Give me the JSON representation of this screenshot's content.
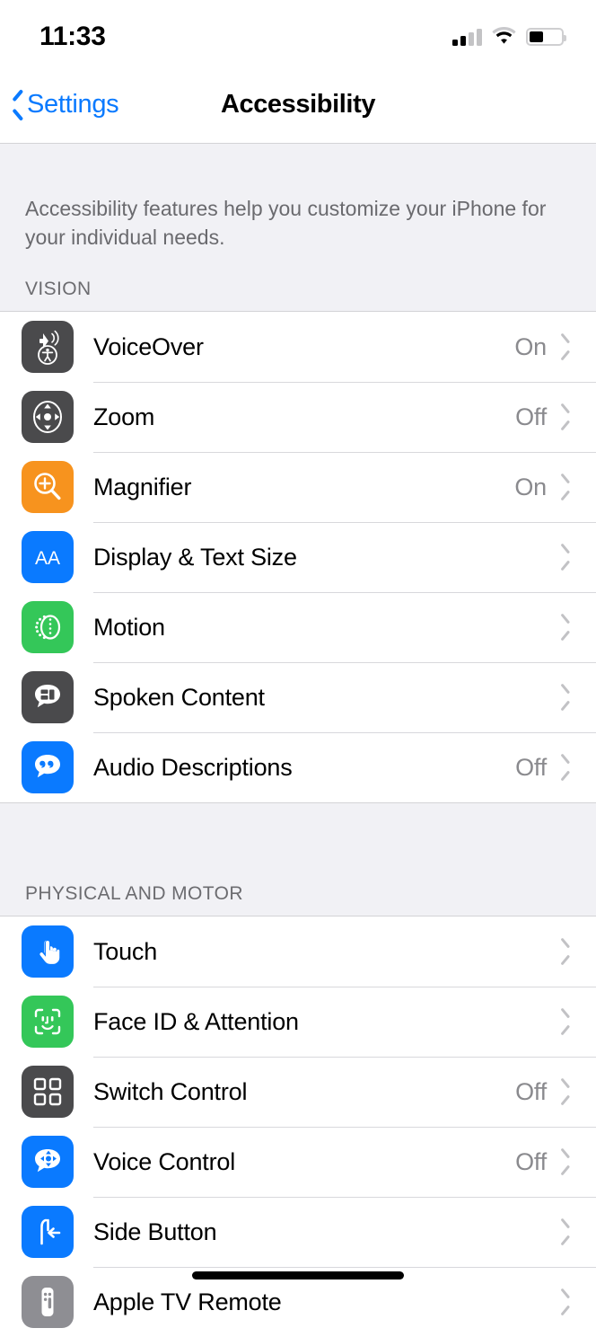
{
  "status_bar": {
    "time": "11:33",
    "signal_icon": "cellular-signal-icon",
    "signal_bars_filled": 2,
    "signal_bars_total": 4,
    "wifi_icon": "wifi-icon",
    "battery_icon": "battery-icon",
    "battery_level_percent": 45
  },
  "nav": {
    "back_label": "Settings",
    "back_icon": "chevron-left-icon",
    "title": "Accessibility"
  },
  "intro": {
    "text": "Accessibility features help you customize your iPhone for your individual needs."
  },
  "sections": [
    {
      "header": "VISION",
      "rows": [
        {
          "label": "VoiceOver",
          "value": "On",
          "icon": "voiceover-icon",
          "icon_color": "#4a4a4c"
        },
        {
          "label": "Zoom",
          "value": "Off",
          "icon": "zoom-icon",
          "icon_color": "#4a4a4c"
        },
        {
          "label": "Magnifier",
          "value": "On",
          "icon": "magnifier-icon",
          "icon_color": "#f7931e"
        },
        {
          "label": "Display & Text Size",
          "value": "",
          "icon": "display-text-size-icon",
          "icon_color": "#0a7aff"
        },
        {
          "label": "Motion",
          "value": "",
          "icon": "motion-icon",
          "icon_color": "#34c759"
        },
        {
          "label": "Spoken Content",
          "value": "",
          "icon": "spoken-content-icon",
          "icon_color": "#4a4a4c"
        },
        {
          "label": "Audio Descriptions",
          "value": "Off",
          "icon": "audio-descriptions-icon",
          "icon_color": "#0a7aff"
        }
      ]
    },
    {
      "header": "PHYSICAL AND MOTOR",
      "rows": [
        {
          "label": "Touch",
          "value": "",
          "icon": "touch-icon",
          "icon_color": "#0a7aff"
        },
        {
          "label": "Face ID & Attention",
          "value": "",
          "icon": "face-id-icon",
          "icon_color": "#34c759"
        },
        {
          "label": "Switch Control",
          "value": "Off",
          "icon": "switch-control-icon",
          "icon_color": "#4a4a4c"
        },
        {
          "label": "Voice Control",
          "value": "Off",
          "icon": "voice-control-icon",
          "icon_color": "#0a7aff"
        },
        {
          "label": "Side Button",
          "value": "",
          "icon": "side-button-icon",
          "icon_color": "#0a7aff"
        },
        {
          "label": "Apple TV Remote",
          "value": "",
          "icon": "apple-tv-remote-icon",
          "icon_color": "#8e8e93"
        }
      ]
    }
  ],
  "chevron_icon": "chevron-right-icon",
  "home_indicator": "home-indicator",
  "colors": {
    "accent": "#0a7aff",
    "group_background": "#f1f1f5",
    "value_text": "#8a8a8e",
    "chevron": "#c2c2c5"
  }
}
